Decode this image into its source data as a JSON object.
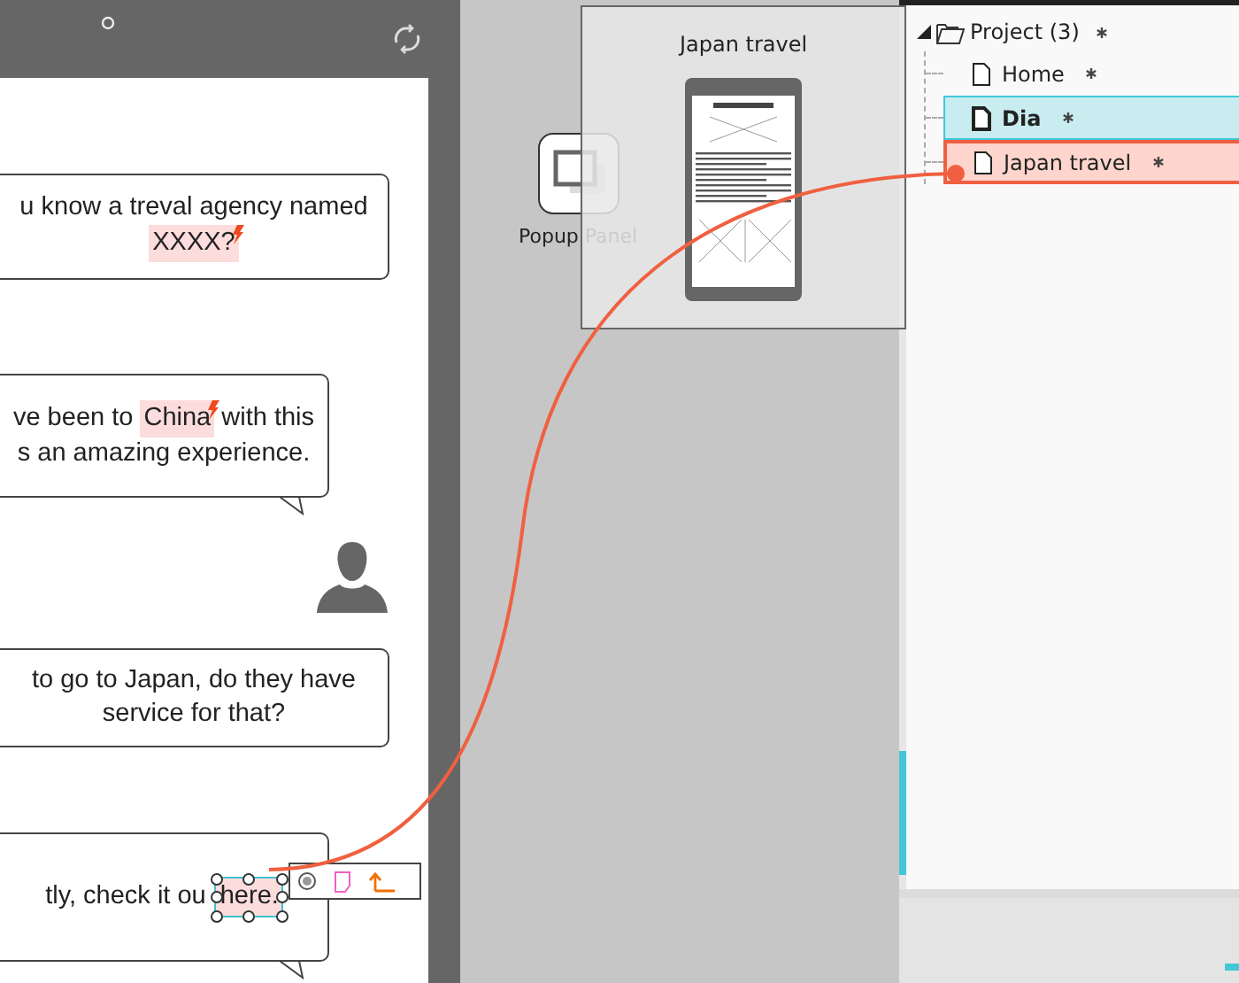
{
  "phone": {
    "messages": [
      {
        "kind": "bubble",
        "tail": false,
        "lines": [
          [
            {
              "text": "u know a treval agency named",
              "highlighted": false
            }
          ],
          [
            {
              "text": "XXXX?",
              "highlighted": true,
              "flagged": true,
              "selected": false
            }
          ]
        ]
      },
      {
        "kind": "bubble",
        "tail": true,
        "lines": [
          [
            {
              "text": "ve been to ",
              "highlighted": false
            },
            {
              "text": "China",
              "highlighted": true,
              "flagged": true,
              "selected": false
            },
            {
              "text": " with this",
              "highlighted": false
            }
          ],
          [
            {
              "text": "s an amazing experience.",
              "highlighted": false
            }
          ]
        ]
      },
      {
        "kind": "avatar"
      },
      {
        "kind": "bubble",
        "tail": false,
        "lines": [
          [
            {
              "text": "to go to Japan, do they have",
              "highlighted": false
            }
          ],
          [
            {
              "text": "service for that?",
              "highlighted": false
            }
          ]
        ]
      },
      {
        "kind": "bubble",
        "tail": true,
        "lines": [
          [
            {
              "text": "tly, check it ou",
              "highlighted": false
            },
            {
              "text": "here.",
              "highlighted": true,
              "flagged": false,
              "selected": true
            }
          ]
        ]
      }
    ]
  },
  "widget": {
    "label": "Popup Panel"
  },
  "preview": {
    "title": "Japan travel"
  },
  "tree": {
    "label": "Project (3)",
    "expanded": true,
    "modified": true,
    "children": [
      {
        "label": "Home",
        "modified": true,
        "selected": false,
        "linked": false
      },
      {
        "label": "Dia",
        "modified": true,
        "selected": true,
        "linked": false
      },
      {
        "label": "Japan travel",
        "modified": true,
        "selected": false,
        "linked": true
      }
    ]
  }
}
